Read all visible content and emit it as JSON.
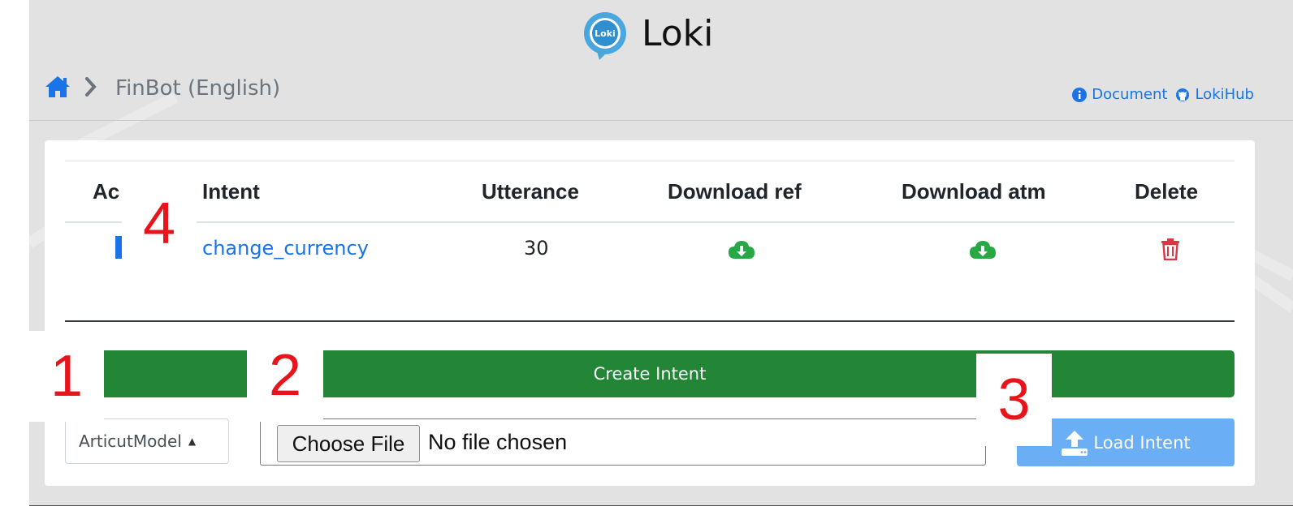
{
  "app": {
    "title": "Loki",
    "logo_text": "Loki"
  },
  "breadcrumb": {
    "home_icon": "home-icon",
    "current": "FinBot (English)"
  },
  "header_links": [
    {
      "label": "Document",
      "icon": "info-circle-icon"
    },
    {
      "label": "LokiHub",
      "icon": "github-icon"
    }
  ],
  "table": {
    "headers": [
      "Ac",
      "Intent",
      "Utterance",
      "Download ref",
      "Download atm",
      "Delete"
    ],
    "rows": [
      {
        "intent": "change_currency",
        "utterance": "30",
        "download_ref": "cloud-download-icon",
        "download_atm": "cloud-download-icon",
        "delete": "trash-icon"
      }
    ]
  },
  "actions": {
    "create_intent": "Create Intent",
    "model_select": "ArticutModel",
    "choose_file": "Choose File",
    "no_file": "No file chosen",
    "load_intent": "Load Intent"
  },
  "callouts": [
    "1",
    "2",
    "3",
    "4"
  ],
  "colors": {
    "green": "#238636",
    "link": "#1a73e8",
    "red": "#dc3545",
    "load_blue": "#6aaef5",
    "callout_red": "#e8141c"
  }
}
